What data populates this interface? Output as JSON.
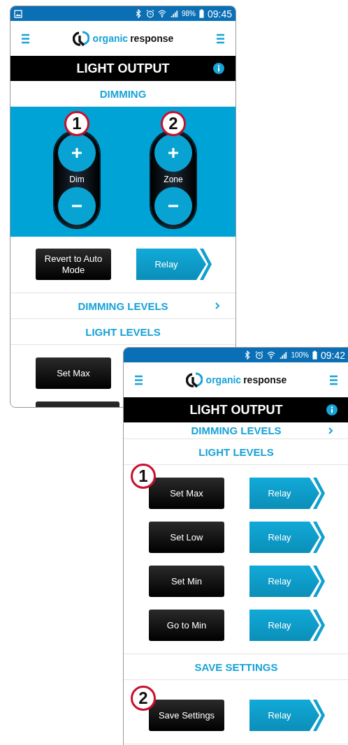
{
  "screens": [
    {
      "status_bar": {
        "notification": true,
        "battery": "98%",
        "time": "09:45"
      },
      "logo": {
        "part_1": "organic",
        "part_2": "response"
      },
      "title": "LIGHT OUTPUT",
      "items": [
        {
          "kind": "heading",
          "text": "DIMMING"
        },
        {
          "kind": "knobs",
          "knobs": [
            {
              "label": "Dim",
              "callout": "1"
            },
            {
              "label": "Zone",
              "callout": "2"
            }
          ]
        },
        {
          "kind": "actions",
          "rows": [
            {
              "button": "Revert to Auto Mode",
              "relay": "Relay"
            }
          ]
        },
        {
          "kind": "nav",
          "text": "DIMMING LEVELS"
        },
        {
          "kind": "heading",
          "text": "LIGHT LEVELS"
        },
        {
          "kind": "actions",
          "rows": [
            {
              "button": "Set Max"
            },
            {}
          ]
        }
      ]
    },
    {
      "status_bar": {
        "notification": false,
        "battery": "100%",
        "time": "09:42"
      },
      "logo": {
        "part_1": "organic",
        "part_2": "response"
      },
      "title": "LIGHT OUTPUT",
      "items": [
        {
          "kind": "nav",
          "text": "DIMMING LEVELS"
        },
        {
          "kind": "heading",
          "text": "LIGHT LEVELS"
        },
        {
          "kind": "actions",
          "rows": [
            {
              "button": "Set Max",
              "relay": "Relay",
              "callout": "1"
            },
            {
              "button": "Set Low",
              "relay": "Relay"
            },
            {
              "button": "Set Min",
              "relay": "Relay"
            },
            {
              "button": "Go to Min",
              "relay": "Relay"
            }
          ]
        },
        {
          "kind": "heading",
          "text": "SAVE SETTINGS"
        },
        {
          "kind": "actions",
          "rows": [
            {
              "button": "Save Settings",
              "relay": "Relay",
              "callout": "2"
            }
          ]
        }
      ]
    }
  ]
}
